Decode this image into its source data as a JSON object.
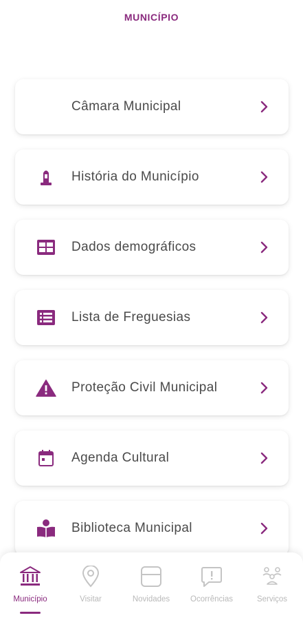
{
  "header": {
    "title": "MUNICÍPIO"
  },
  "menu": {
    "items": [
      {
        "label": "Câmara Municipal",
        "icon": "none"
      },
      {
        "label": "História do Município",
        "icon": "monument-icon"
      },
      {
        "label": "Dados demográficos",
        "icon": "grid-table-icon"
      },
      {
        "label": "Lista de Freguesias",
        "icon": "list-icon"
      },
      {
        "label": "Proteção Civil Municipal",
        "icon": "warning-icon"
      },
      {
        "label": "Agenda Cultural",
        "icon": "calendar-icon"
      },
      {
        "label": "Biblioteca Municipal",
        "icon": "reader-icon"
      }
    ]
  },
  "bottom_nav": {
    "items": [
      {
        "label": "Município",
        "icon": "building-icon",
        "active": true
      },
      {
        "label": "Visitar",
        "icon": "location-pin-icon",
        "active": false
      },
      {
        "label": "Novidades",
        "icon": "news-icon",
        "active": false
      },
      {
        "label": "Ocorrências",
        "icon": "report-bubble-icon",
        "active": false
      },
      {
        "label": "Serviços",
        "icon": "services-icon",
        "active": false
      }
    ]
  },
  "colors": {
    "accent": "#8a2a7e",
    "inactive": "#b9b9b9",
    "text": "#4a4a4a"
  }
}
